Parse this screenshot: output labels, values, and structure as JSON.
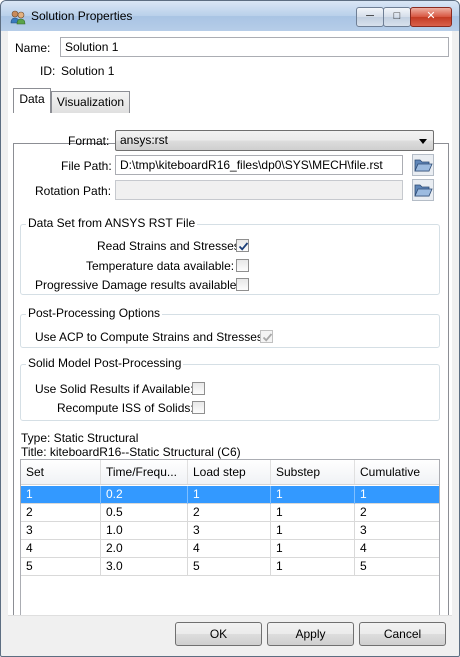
{
  "window": {
    "title": "Solution Properties",
    "controls": {
      "minimize": "─",
      "maximize": "□",
      "close": "✕"
    }
  },
  "header": {
    "name_label": "Name:",
    "name_value": "Solution 1",
    "id_label": "ID:",
    "id_value": "Solution 1"
  },
  "tabs": [
    {
      "label": "Data",
      "active": true
    },
    {
      "label": "Visualization",
      "active": false
    }
  ],
  "data_tab": {
    "format_label": "Format:",
    "format_value": "ansys:rst",
    "file_path_label": "File Path:",
    "file_path_value": "D:\\tmp\\kiteboardR16_files\\dp0\\SYS\\MECH\\file.rst",
    "rotation_path_label": "Rotation Path:",
    "rotation_path_value": "",
    "data_set_group": {
      "title": "Data Set from ANSYS RST File",
      "read_strains_label": "Read Strains and Stresses:",
      "read_strains_checked": true,
      "temperature_label": "Temperature data available:",
      "temperature_checked": false,
      "progressive_label": "Progressive Damage results available:",
      "progressive_checked": false
    },
    "post_processing_group": {
      "title": "Post-Processing Options",
      "use_acp_label": "Use ACP to Compute Strains and Stresses:",
      "use_acp_checked": true
    },
    "solid_model_group": {
      "title": "Solid Model Post-Processing",
      "use_solid_label": "Use Solid Results if Available:",
      "use_solid_checked": false,
      "recompute_label": "Recompute ISS of Solids:",
      "recompute_checked": false
    },
    "type_text": "Type: Static Structural",
    "title_text": "Title: kiteboardR16--Static Structural (C6)",
    "table": {
      "columns": [
        "Set",
        "Time/Frequ...",
        "Load step",
        "Substep",
        "Cumulative"
      ],
      "rows": [
        [
          "1",
          "0.2",
          "1",
          "1",
          "1"
        ],
        [
          "2",
          "0.5",
          "2",
          "1",
          "2"
        ],
        [
          "3",
          "1.0",
          "3",
          "1",
          "3"
        ],
        [
          "4",
          "2.0",
          "4",
          "1",
          "4"
        ],
        [
          "5",
          "3.0",
          "5",
          "1",
          "5"
        ]
      ],
      "selected_row": 0
    }
  },
  "buttons": {
    "ok": "OK",
    "apply": "Apply",
    "cancel": "Cancel"
  },
  "colors": {
    "selection": "#3399ff",
    "titlebar": "#b9d0ea",
    "close_button": "#c33a23"
  }
}
